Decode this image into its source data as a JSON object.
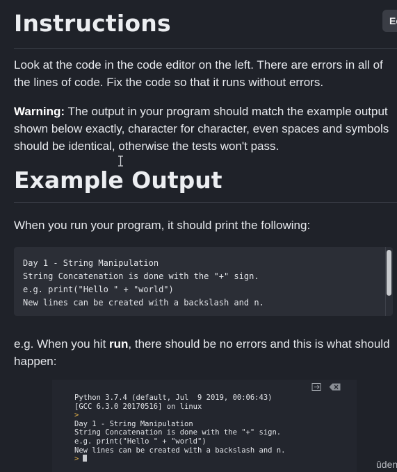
{
  "header": {
    "title": "Instructions",
    "edit_label": "Ec"
  },
  "intro": {
    "text": "Look at the code in the code editor on the left. There are errors in all of the lines of code. Fix the code so that it runs without errors."
  },
  "warning": {
    "label": "Warning:",
    "text": " The output in your program should match the example output shown below exactly, character for character, even spaces and symbols should be identical, otherwise the tests won't pass."
  },
  "example": {
    "title": "Example Output",
    "lead": "When you run your program, it should print the following:",
    "code_lines": [
      "Day 1 - String Manipulation",
      "String Concatenation is done with the \"+\" sign.",
      "e.g. print(\"Hello \" + \"world\")",
      "New lines can be created with a backslash and n."
    ]
  },
  "run_hint": {
    "before": "e.g. When you hit ",
    "keyword": "run",
    "after": ", there should be no errors and this is what should happen:"
  },
  "terminal": {
    "header_lines": [
      "Python 3.7.4 (default, Jul  9 2019, 00:06:43)",
      "[GCC 6.3.0 20170516] on linux"
    ],
    "prompt": ">",
    "output_lines": [
      "Day 1 - String Manipulation",
      "String Concatenation is done with the \"+\" sign.",
      "e.g. print(\"Hello \" + \"world\")",
      "New lines can be created with a backslash and n."
    ],
    "icons": [
      "exit-terminal-icon",
      "clear-terminal-icon"
    ]
  },
  "watermark": {
    "text": "ûden"
  }
}
